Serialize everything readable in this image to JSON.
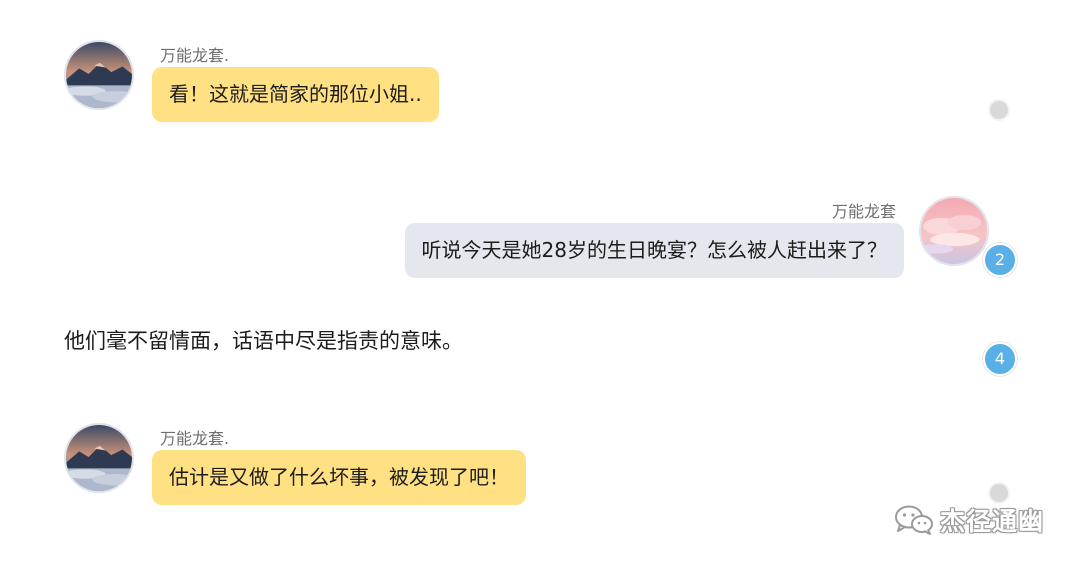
{
  "messages": [
    {
      "side": "left",
      "sender": "万能龙套.",
      "text": "看！这就是简家的那位小姐..",
      "bubble_color": "#ffe082",
      "avatar": "mountain-landscape-icon"
    },
    {
      "side": "right",
      "sender": "万能龙套",
      "text": "听说今天是她28岁的生日晚宴？怎么被人赶出来了？",
      "bubble_color": "#e4e8ee",
      "avatar": "pink-cloud-sky-icon"
    },
    {
      "side": "narration",
      "text": "他们毫不留情面，话语中尽是指责的意味。"
    },
    {
      "side": "left",
      "sender": "万能龙套.",
      "text": "估计是又做了什么坏事，被发现了吧！",
      "bubble_color": "#ffe082",
      "avatar": "mountain-landscape-icon"
    }
  ],
  "markers": {
    "badge_2": "2",
    "badge_4": "4",
    "badge_color": "#5ab0e6",
    "dot_color": "#d9d9d9"
  },
  "watermark": {
    "icon": "wechat-icon",
    "text": "杰径通幽"
  }
}
